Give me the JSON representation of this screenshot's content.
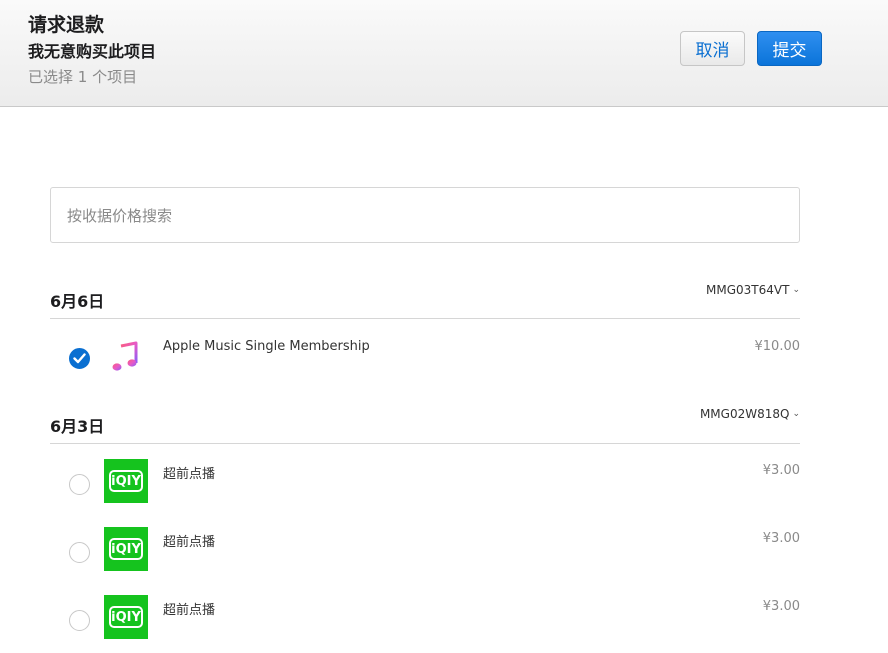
{
  "header": {
    "title": "请求退款",
    "reason": "我无意购买此项目",
    "selected_count": "已选择 1 个项目",
    "cancel_label": "取消",
    "submit_label": "提交"
  },
  "search": {
    "placeholder": "按收据价格搜索"
  },
  "groups": [
    {
      "date": "6月6日",
      "order_id": "MMG03T64VT",
      "items": [
        {
          "name": "Apple Music Single Membership",
          "price": "¥10.00",
          "checked": true,
          "icon": "music-note-icon"
        }
      ]
    },
    {
      "date": "6月3日",
      "order_id": "MMG02W818Q",
      "items": [
        {
          "name": "超前点播",
          "price": "¥3.00",
          "checked": false,
          "icon": "iqiyi-icon"
        },
        {
          "name": "超前点播",
          "price": "¥3.00",
          "checked": false,
          "icon": "iqiyi-icon"
        },
        {
          "name": "超前点播",
          "price": "¥3.00",
          "checked": false,
          "icon": "iqiyi-icon"
        }
      ]
    }
  ],
  "icons": {
    "iqiyi_logo_text": "iQIY"
  },
  "colors": {
    "accent": "#0a6fd1",
    "iqiyi_green": "#15c31e"
  }
}
